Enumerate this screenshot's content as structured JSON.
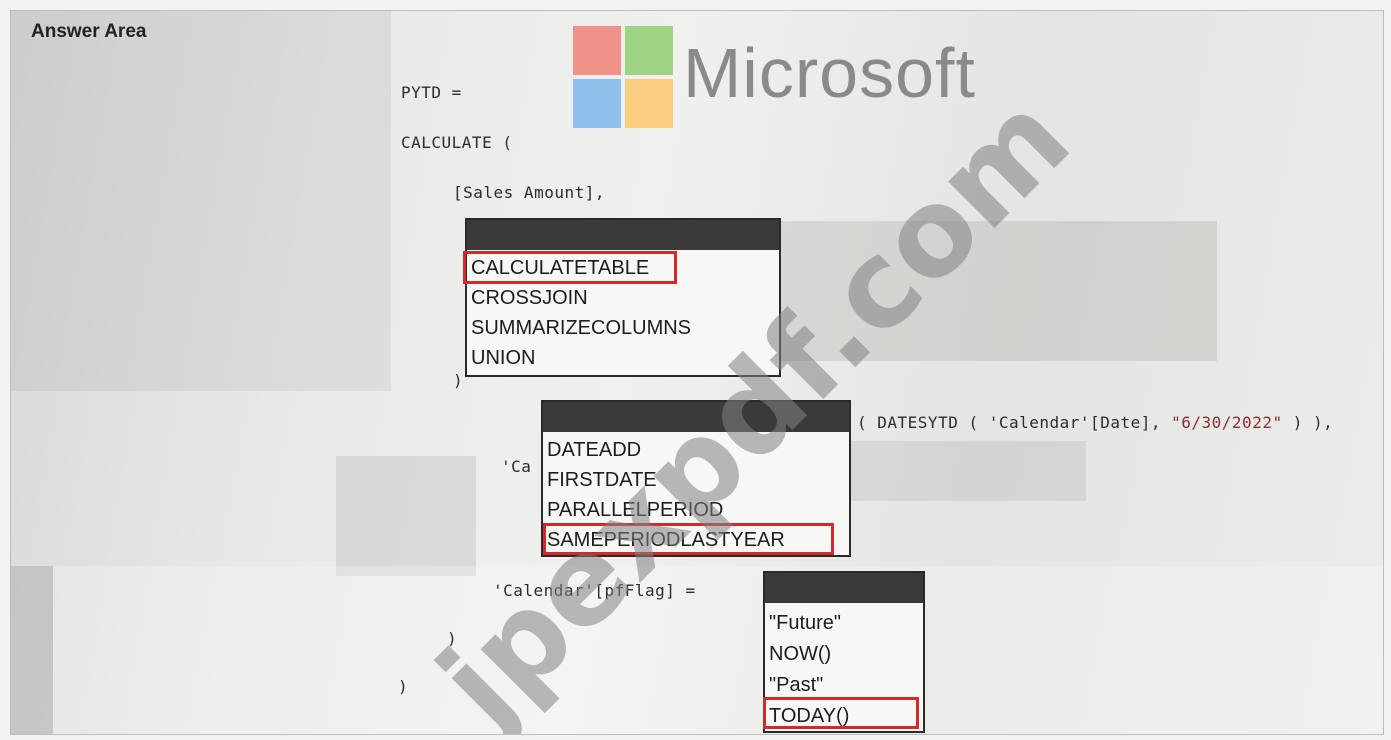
{
  "answer_area": {
    "title": "Answer Area"
  },
  "branding": {
    "logo_text": "Microsoft",
    "watermark": "jpexpdf.com"
  },
  "code": {
    "line_pytd": "PYTD =",
    "line_calculate": "CALCULATE (",
    "line_sales": "[Sales Amount],",
    "line_close_paren_1": ")",
    "line_datesytd_prefix": "( DATESYTD ( 'Calendar'[Date], ",
    "line_datesytd_string": "\"6/30/2022\"",
    "line_datesytd_suffix": " ) ),",
    "line_calendar_partial": "'Ca",
    "line_pfflag": "'Calendar'[pfFlag] =",
    "line_close_paren_2": ")",
    "line_close_paren_3": ")"
  },
  "dropdown1": {
    "options": [
      "CALCULATETABLE",
      "CROSSJOIN",
      "SUMMARIZECOLUMNS",
      "UNION"
    ],
    "selected": "CALCULATETABLE"
  },
  "dropdown2": {
    "options": [
      "DATEADD",
      "FIRSTDATE",
      "PARALLELPERIOD",
      "SAMEPERIODLASTYEAR"
    ],
    "selected": "SAMEPERIODLASTYEAR"
  },
  "dropdown3": {
    "options": [
      "\"Future\"",
      "NOW()",
      "\"Past\"",
      "TODAY()"
    ],
    "selected": "TODAY()"
  },
  "colors": {
    "highlight": "#d22a2a",
    "dropdown_header": "#3a3a3a",
    "ms_red": "#f0918a",
    "ms_green": "#9fd485",
    "ms_blue": "#8ec0ec",
    "ms_yellow": "#f8cf80"
  }
}
